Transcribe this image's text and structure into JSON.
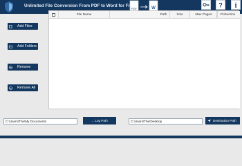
{
  "header": {
    "title": "Unlimited File Conversion From PDF to Word for Free",
    "conv_from": "PDF",
    "conv_to": "W"
  },
  "sidebar": {
    "add_files": "Add Files",
    "add_folders": "Add Folders",
    "remove": "Remove",
    "remove_all": "Remove All"
  },
  "table": {
    "columns": [
      "File Name",
      "Path",
      "Size",
      "Max Pages",
      "Protection"
    ]
  },
  "bottom": {
    "source_path": "C:\\Users\\The\\My Documents",
    "log_path_label": "... Log Path",
    "dest_path": "C:\\Users\\The\\Desktop",
    "dest_button_label": "Destination Path"
  },
  "colors": {
    "brand": "#13375f"
  }
}
